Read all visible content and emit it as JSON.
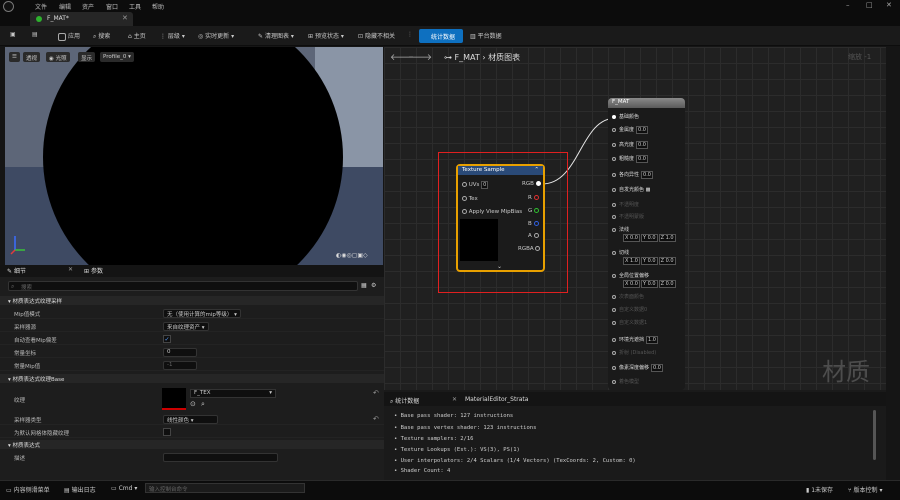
{
  "menu": [
    "文件",
    "编辑",
    "资产",
    "窗口",
    "工具",
    "帮助"
  ],
  "window_controls": [
    "–",
    "□",
    "✕"
  ],
  "tab": {
    "title": "F_MAT*"
  },
  "toolbar": {
    "apply": "应用",
    "search": "搜索",
    "home": "主页",
    "hierarchy": "层级",
    "live_update": "实时更新",
    "clean_graph": "清理图表",
    "preview_state": "预览状态",
    "hide_unrelated": "隐藏不相关",
    "stats": "统计数据",
    "platform_stats": "平台数据"
  },
  "viewport": {
    "perspective": "透视",
    "lit": "光照",
    "show": "显示",
    "profile": "Profile_0"
  },
  "details": {
    "tab_details": "细节",
    "tab_params": "参数",
    "search_placeholder": "搜索",
    "sections": [
      {
        "title": "材质表达式纹理采样",
        "rows": [
          {
            "label": "Mip值模式",
            "value": "无（使用计算的mip等级）"
          },
          {
            "label": "采样器源",
            "value": "来自纹理资产"
          },
          {
            "label": "自动查看Mip偏差",
            "value": "✓"
          },
          {
            "label": "常量坐标",
            "value": "0"
          },
          {
            "label": "常量Mip值",
            "value": "-1"
          }
        ]
      },
      {
        "title": "材质表达式纹理Base",
        "rows": [
          {
            "label": "纹理",
            "value": "F_TEX"
          },
          {
            "label": "采样器类型",
            "value": "线性颜色"
          },
          {
            "label": "为默认网格体隐藏纹理",
            "value": ""
          }
        ]
      },
      {
        "title": "材质表达式",
        "rows": [
          {
            "label": "描述",
            "value": ""
          }
        ]
      }
    ]
  },
  "graph": {
    "breadcrumb": "F_MAT",
    "breadcrumb_sub": "材质图表",
    "zoom": "缩放 -1",
    "watermark": "材质"
  },
  "texture_node": {
    "title": "Texture Sample",
    "inputs": [
      {
        "label": "UVs",
        "value": "0"
      },
      {
        "label": "Tex",
        "value": ""
      },
      {
        "label": "Apply View MipBias",
        "value": ""
      }
    ],
    "outputs": [
      "RGB",
      "R",
      "G",
      "B",
      "A",
      "RGBA"
    ]
  },
  "material_node": {
    "title": "F_MAT",
    "pins": [
      {
        "label": "基础颜色",
        "values": [],
        "enabled": true
      },
      {
        "label": "金属度",
        "values": [
          "0.0"
        ],
        "enabled": true
      },
      {
        "label": "高光度",
        "values": [
          "0.0"
        ],
        "enabled": true
      },
      {
        "label": "粗糙度",
        "values": [
          "0.0"
        ],
        "enabled": true
      },
      {
        "label": "各向异性",
        "values": [
          "0.0"
        ],
        "enabled": true
      },
      {
        "label": "自发光颜色",
        "values": [],
        "enabled": true
      },
      {
        "label": "不透明度",
        "values": [],
        "enabled": false
      },
      {
        "label": "不透明蒙版",
        "values": [],
        "enabled": false
      },
      {
        "label": "法线",
        "values": [
          "X 0.0",
          "Y 0.0",
          "Z 1.0"
        ],
        "enabled": true
      },
      {
        "label": "切线",
        "values": [
          "X 1.0",
          "Y 0.0",
          "Z 0.0"
        ],
        "enabled": true
      },
      {
        "label": "全局位置偏移",
        "values": [
          "X 0.0",
          "Y 0.0",
          "Z 0.0"
        ],
        "enabled": true
      },
      {
        "label": "次表面颜色",
        "values": [],
        "enabled": false
      },
      {
        "label": "自定义数据0",
        "values": [],
        "enabled": false
      },
      {
        "label": "自定义数据1",
        "values": [],
        "enabled": false
      },
      {
        "label": "环境光遮挡",
        "values": [
          "1.0"
        ],
        "enabled": true
      },
      {
        "label": "折射 (Disabled)",
        "values": [],
        "enabled": false
      },
      {
        "label": "像素深度偏移",
        "values": [
          "0.0"
        ],
        "enabled": true
      },
      {
        "label": "着色模型",
        "values": [],
        "enabled": false
      }
    ]
  },
  "stats_panel": {
    "tab_stats": "统计数据",
    "tab_strata": "MaterialEditor_Strata",
    "lines": [
      "Base pass shader: 127 instructions",
      "Base pass vertex shader: 123 instructions",
      "Texture samplers: 2/16",
      "Texture Lookups (Est.): VS(3), PS(1)",
      "User interpolators: 2/4 Scalars (1/4 Vectors) (TexCoords: 2, Custom: 0)",
      "Shader Count: 4"
    ]
  },
  "statusbar": {
    "content_drawer": "内容侧滑菜单",
    "output_log": "输出日志",
    "cmd": "Cmd",
    "cmd_placeholder": "输入控制台命令",
    "unsaved": "1未保存",
    "source_control": "版本控制"
  },
  "colors": {
    "accent": "#0e70c0",
    "node_highlight": "#e02020",
    "selected_node_border": "#e8a000"
  }
}
